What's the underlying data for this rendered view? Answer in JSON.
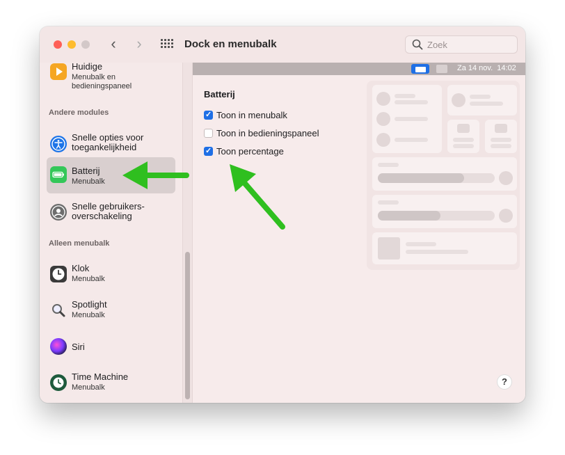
{
  "window": {
    "title": "Dock en menubalk"
  },
  "search": {
    "placeholder": "Zoek"
  },
  "sidebar": {
    "top_item": {
      "label": "Huidige",
      "sub": "Menubalk en\nbedieningspaneel"
    },
    "section_other": "Andere modules",
    "other_items": [
      {
        "label": "Snelle opties voor\ntoegankelijkheid",
        "sub": "",
        "icon": "accessibility-icon"
      },
      {
        "label": "Batterij",
        "sub": "Menubalk",
        "icon": "battery-icon",
        "selected": true
      },
      {
        "label": "Snelle gebruikers-\noverschakeling",
        "sub": "",
        "icon": "user-switch-icon"
      }
    ],
    "section_menubar": "Alleen menubalk",
    "menubar_items": [
      {
        "label": "Klok",
        "sub": "Menubalk",
        "icon": "clock-icon"
      },
      {
        "label": "Spotlight",
        "sub": "Menubalk",
        "icon": "spotlight-icon"
      },
      {
        "label": "Siri",
        "sub": "",
        "icon": "siri-icon"
      },
      {
        "label": "Time Machine",
        "sub": "Menubalk",
        "icon": "time-machine-icon"
      }
    ]
  },
  "menubar_preview": {
    "clock": "Za 14 nov.  14:02"
  },
  "main": {
    "heading": "Batterij",
    "options": [
      {
        "label": "Toon in menubalk",
        "checked": true
      },
      {
        "label": "Toon in bedieningspaneel",
        "checked": false
      },
      {
        "label": "Toon percentage",
        "checked": true
      }
    ]
  },
  "help": {
    "label": "?"
  },
  "colors": {
    "accent": "#1f6fe5",
    "arrow": "#2fbf1f"
  }
}
